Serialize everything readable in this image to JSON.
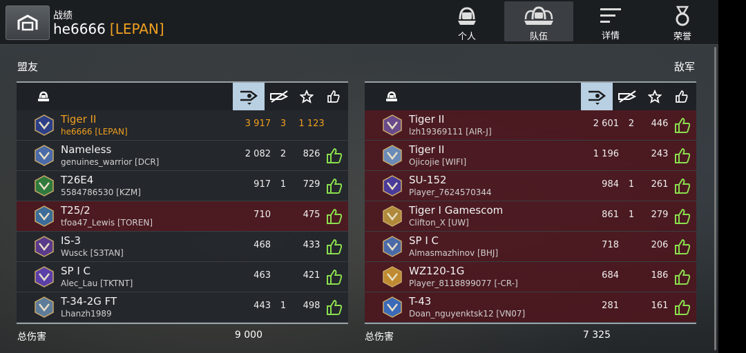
{
  "header": {
    "section_label": "战绩",
    "player_name": "he6666",
    "player_clan": "[LEPAN]",
    "tabs": [
      {
        "label": "个人",
        "icon": "personal-helmet-icon"
      },
      {
        "label": "队伍",
        "icon": "team-helmets-icon",
        "active": true
      },
      {
        "label": "详情",
        "icon": "details-list-icon"
      },
      {
        "label": "荣誉",
        "icon": "honor-medal-icon"
      }
    ]
  },
  "allies": {
    "title": "盟友",
    "total_label": "总伤害",
    "total_value": "9 000",
    "rows": [
      {
        "tank": "Tiger II",
        "player": "he6666 [LEPAN]",
        "damage": "3 917",
        "kills": "3",
        "xp": "1 123",
        "me": true,
        "liked": false,
        "badge_color": "#2c3f86"
      },
      {
        "tank": "Nameless",
        "player": "genuines_warrior [DCR]",
        "damage": "2 082",
        "kills": "2",
        "xp": "826",
        "me": false,
        "liked": true,
        "badge_color": "#4a6aa8"
      },
      {
        "tank": "T26E4",
        "player": "5584786530 [KZM]",
        "damage": "917",
        "kills": "1",
        "xp": "729",
        "me": false,
        "liked": true,
        "badge_color": "#2f7a3c"
      },
      {
        "tank": "T25/2",
        "player": "tfoa47_Lewis [TOREN]",
        "damage": "710",
        "kills": "",
        "xp": "475",
        "me": false,
        "liked": true,
        "badge_color": "#3b6c9a",
        "enemyTint": true
      },
      {
        "tank": "IS-3",
        "player": "Wusck [S3TAN]",
        "damage": "468",
        "kills": "",
        "xp": "433",
        "me": false,
        "liked": true,
        "badge_color": "#5a3a8a"
      },
      {
        "tank": "SP I C",
        "player": "Alec_Lau [TKTNT]",
        "damage": "463",
        "kills": "",
        "xp": "421",
        "me": false,
        "liked": true,
        "badge_color": "#5b3fa8"
      },
      {
        "tank": "T-34-2G FT",
        "player": "Lhanzh1989",
        "damage": "443",
        "kills": "1",
        "xp": "498",
        "me": false,
        "liked": true,
        "badge_color": "#5e7c9a"
      }
    ]
  },
  "enemies": {
    "title": "敌军",
    "total_label": "总伤害",
    "total_value": "7 325",
    "rows": [
      {
        "tank": "Tiger II",
        "player": "lzh19369111 [AIR-J]",
        "damage": "2 601",
        "kills": "2",
        "xp": "446",
        "liked": true,
        "badge_color": "#6a4a8a"
      },
      {
        "tank": "Tiger II",
        "player": "Ojicojie [WIFI]",
        "damage": "1 196",
        "kills": "",
        "xp": "243",
        "liked": true,
        "badge_color": "#6b8bb8"
      },
      {
        "tank": "SU-152",
        "player": "Player_7624570344",
        "damage": "984",
        "kills": "1",
        "xp": "261",
        "liked": true,
        "badge_color": "#4a3a9a"
      },
      {
        "tank": "Tiger I Gamescom",
        "player": "Clifton_X [UW]",
        "damage": "861",
        "kills": "1",
        "xp": "279",
        "liked": true,
        "badge_color": "#b08a3a"
      },
      {
        "tank": "SP I C",
        "player": "Almasmazhinov [BHJ]",
        "damage": "718",
        "kills": "",
        "xp": "206",
        "liked": true,
        "badge_color": "#4a6aa8"
      },
      {
        "tank": "WZ120-1G",
        "player": "Player_8118899077 [-CR-]",
        "damage": "684",
        "kills": "",
        "xp": "186",
        "liked": true,
        "badge_color": "#c08a30"
      },
      {
        "tank": "T-43",
        "player": "Doan_nguyenktsk12 [VN07]",
        "damage": "281",
        "kills": "",
        "xp": "161",
        "liked": true,
        "badge_color": "#3a6ab8"
      }
    ]
  },
  "colors": {
    "accent_orange": "#f0a020",
    "like_green": "#8be04e",
    "enemy_row": "#4e161e",
    "sorted_header": "#b9cfe2"
  }
}
